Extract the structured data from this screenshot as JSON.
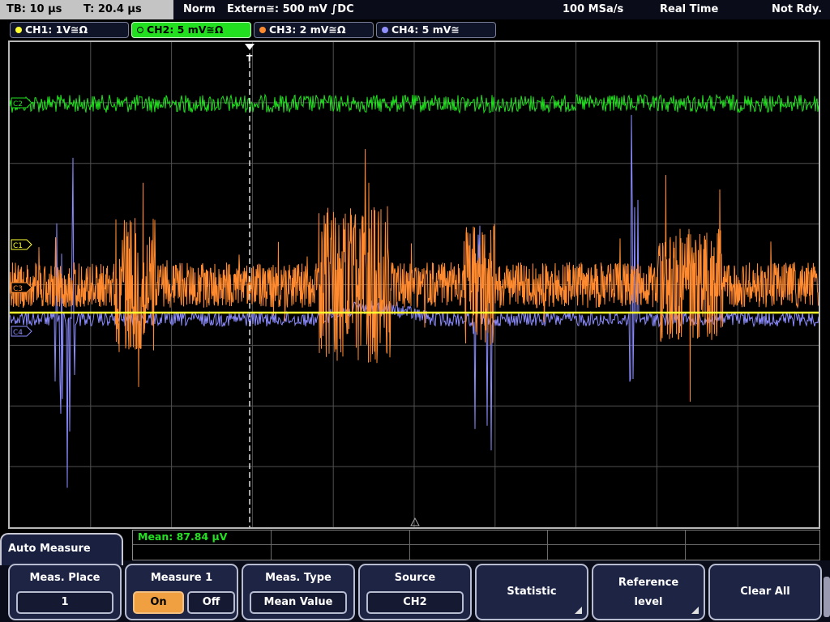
{
  "status_bar": {
    "timebase": "TB: 10 µs",
    "trigger_time": "T: 20.4 µs",
    "trigger_mode": "Norm",
    "trigger_source": "Extern≅: 500 mV ∫DC",
    "sample_rate": "100 MSa/s",
    "acquisition_mode": "Real Time",
    "status": "Not Rdy."
  },
  "channels": [
    {
      "label": "CH1: 1V≅Ω",
      "color": "#ffff30"
    },
    {
      "label": "CH2: 5 mV≅Ω",
      "color": "#22e020",
      "active": true
    },
    {
      "label": "CH3: 2 mV≅Ω",
      "color": "#ff8a30"
    },
    {
      "label": "CH4: 5 mV≅",
      "color": "#9090ff"
    }
  ],
  "markers": {
    "ch1": "C1",
    "ch2": "C2",
    "ch3": "C3",
    "ch4": "C4",
    "trigger": "T"
  },
  "measurement": {
    "result": "Mean: 87.84 µV"
  },
  "menu": {
    "title": "Auto Measure",
    "meas_place": {
      "label": "Meas. Place",
      "value": "1"
    },
    "measure1": {
      "label": "Measure 1",
      "on": "On",
      "off": "Off"
    },
    "meas_type": {
      "label": "Meas. Type",
      "value": "Mean Value"
    },
    "source": {
      "label": "Source",
      "value": "CH2"
    },
    "statistic": {
      "label": "Statistic"
    },
    "reference_level": {
      "line1": "Reference",
      "line2": "level"
    },
    "clear_all": {
      "label": "Clear All"
    }
  },
  "colors": {
    "ch1": "#ffff30",
    "ch2": "#22e020",
    "ch3": "#ff8a30",
    "ch4": "#8c8cff",
    "grid": "#555555",
    "accent_on": "#f0a040"
  }
}
